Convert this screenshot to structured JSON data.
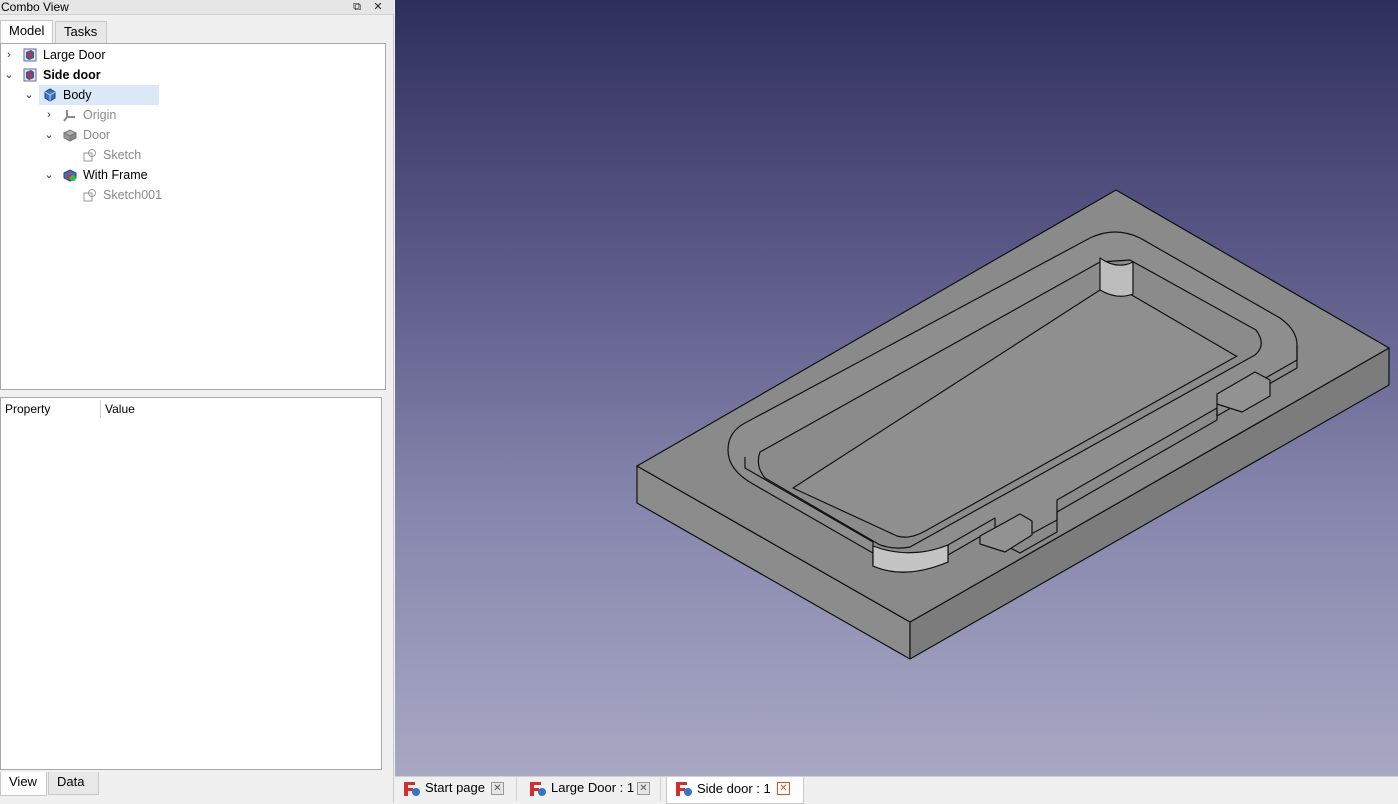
{
  "combo": {
    "title": "Combo View",
    "float_glyph": "⧉",
    "close_glyph": "✕",
    "tabs": [
      {
        "label": "Model"
      },
      {
        "label": "Tasks"
      }
    ],
    "tree": [
      {
        "label": "Large Door",
        "expanded": false,
        "icon": "part-design-document-icon"
      },
      {
        "label": "Side door",
        "expanded": true,
        "icon": "part-design-document-icon"
      },
      {
        "label": "Body",
        "expanded": true,
        "icon": "body-icon"
      },
      {
        "label": "Origin",
        "expanded": false,
        "icon": "origin-icon"
      },
      {
        "label": "Door",
        "expanded": true,
        "icon": "pad-icon"
      },
      {
        "label": "Sketch",
        "icon": "sketch-icon"
      },
      {
        "label": "With Frame",
        "expanded": true,
        "icon": "pocket-icon"
      },
      {
        "label": "Sketch001",
        "icon": "sketch-icon"
      }
    ],
    "properties": {
      "col_property": "Property",
      "col_value": "Value"
    },
    "bottom_tabs": [
      {
        "label": "View"
      },
      {
        "label": "Data"
      }
    ]
  },
  "doc_tabs": [
    {
      "label": "Start page",
      "active": false
    },
    {
      "label": "Large Door : 1",
      "active": false
    },
    {
      "label": "Side door : 1",
      "active": true
    }
  ],
  "colors": {
    "viewport_top": "#2f2f5e",
    "viewport_bottom": "#a8a8c4",
    "model_face": "#8a8a8a",
    "selection": "#dbe8f7",
    "close_active": "#d9541e"
  }
}
